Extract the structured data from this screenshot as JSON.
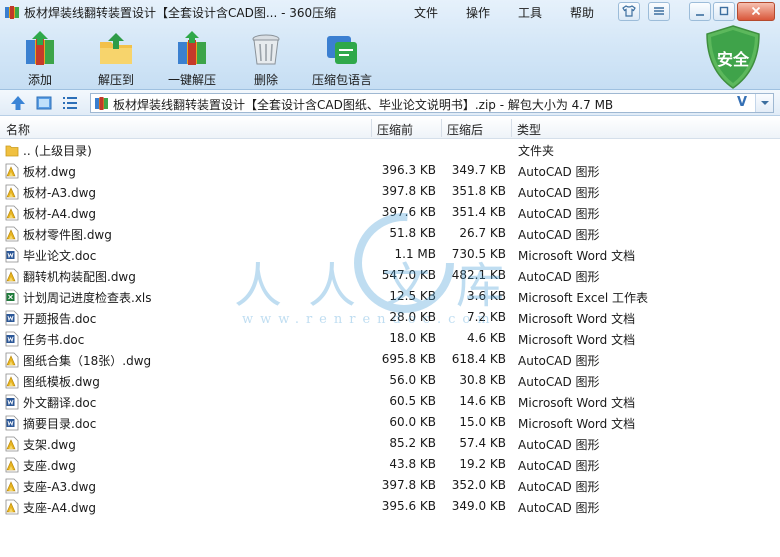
{
  "window": {
    "title": "板材焊装线翻转装置设计【全套设计含CAD图... - 360压缩",
    "menu": [
      "文件",
      "操作",
      "工具",
      "帮助"
    ]
  },
  "toolbar": {
    "add": "添加",
    "extract_to": "解压到",
    "one_click_extract": "一键解压",
    "delete": "删除",
    "zip_language": "压缩包语言",
    "security_badge": "安全"
  },
  "address": {
    "path": "板材焊装线翻转装置设计【全套设计含CAD图纸、毕业论文说明书】.zip - 解包大小为 4.7 MB",
    "v_mark": "V"
  },
  "columns": {
    "name": "名称",
    "size": "压缩前",
    "packed": "压缩后",
    "type": "类型"
  },
  "files": [
    {
      "icon": "folder-up",
      "name": ".. (上级目录)",
      "size": "",
      "packed": "",
      "type": "文件夹"
    },
    {
      "icon": "dwg",
      "name": "板材.dwg",
      "size": "396.3 KB",
      "packed": "349.7 KB",
      "type": "AutoCAD 图形"
    },
    {
      "icon": "dwg",
      "name": "板材-A3.dwg",
      "size": "397.8 KB",
      "packed": "351.8 KB",
      "type": "AutoCAD 图形"
    },
    {
      "icon": "dwg",
      "name": "板材-A4.dwg",
      "size": "397.6 KB",
      "packed": "351.4 KB",
      "type": "AutoCAD 图形"
    },
    {
      "icon": "dwg",
      "name": "板材零件图.dwg",
      "size": "51.8 KB",
      "packed": "26.7 KB",
      "type": "AutoCAD 图形"
    },
    {
      "icon": "doc",
      "name": "毕业论文.doc",
      "size": "1.1 MB",
      "packed": "730.5 KB",
      "type": "Microsoft Word 文档"
    },
    {
      "icon": "dwg",
      "name": "翻转机构装配图.dwg",
      "size": "547.0 KB",
      "packed": "482.1 KB",
      "type": "AutoCAD 图形"
    },
    {
      "icon": "xls",
      "name": "计划周记进度检查表.xls",
      "size": "12.5 KB",
      "packed": "3.6 KB",
      "type": "Microsoft Excel 工作表"
    },
    {
      "icon": "doc",
      "name": "开题报告.doc",
      "size": "28.0 KB",
      "packed": "7.2 KB",
      "type": "Microsoft Word 文档"
    },
    {
      "icon": "doc",
      "name": "任务书.doc",
      "size": "18.0 KB",
      "packed": "4.6 KB",
      "type": "Microsoft Word 文档"
    },
    {
      "icon": "dwg",
      "name": "图纸合集（18张）.dwg",
      "size": "695.8 KB",
      "packed": "618.4 KB",
      "type": "AutoCAD 图形"
    },
    {
      "icon": "dwg",
      "name": "图纸模板.dwg",
      "size": "56.0 KB",
      "packed": "30.8 KB",
      "type": "AutoCAD 图形"
    },
    {
      "icon": "doc",
      "name": "外文翻译.doc",
      "size": "60.5 KB",
      "packed": "14.6 KB",
      "type": "Microsoft Word 文档"
    },
    {
      "icon": "doc",
      "name": "摘要目录.doc",
      "size": "60.0 KB",
      "packed": "15.0 KB",
      "type": "Microsoft Word 文档"
    },
    {
      "icon": "dwg",
      "name": "支架.dwg",
      "size": "85.2 KB",
      "packed": "57.4 KB",
      "type": "AutoCAD 图形"
    },
    {
      "icon": "dwg",
      "name": "支座.dwg",
      "size": "43.8 KB",
      "packed": "19.2 KB",
      "type": "AutoCAD 图形"
    },
    {
      "icon": "dwg",
      "name": "支座-A3.dwg",
      "size": "397.8 KB",
      "packed": "352.0 KB",
      "type": "AutoCAD 图形"
    },
    {
      "icon": "dwg",
      "name": "支座-A4.dwg",
      "size": "395.6 KB",
      "packed": "349.0 KB",
      "type": "AutoCAD 图形"
    }
  ],
  "watermark": {
    "text": "人人文库",
    "url": "www.renrendoc.com"
  }
}
